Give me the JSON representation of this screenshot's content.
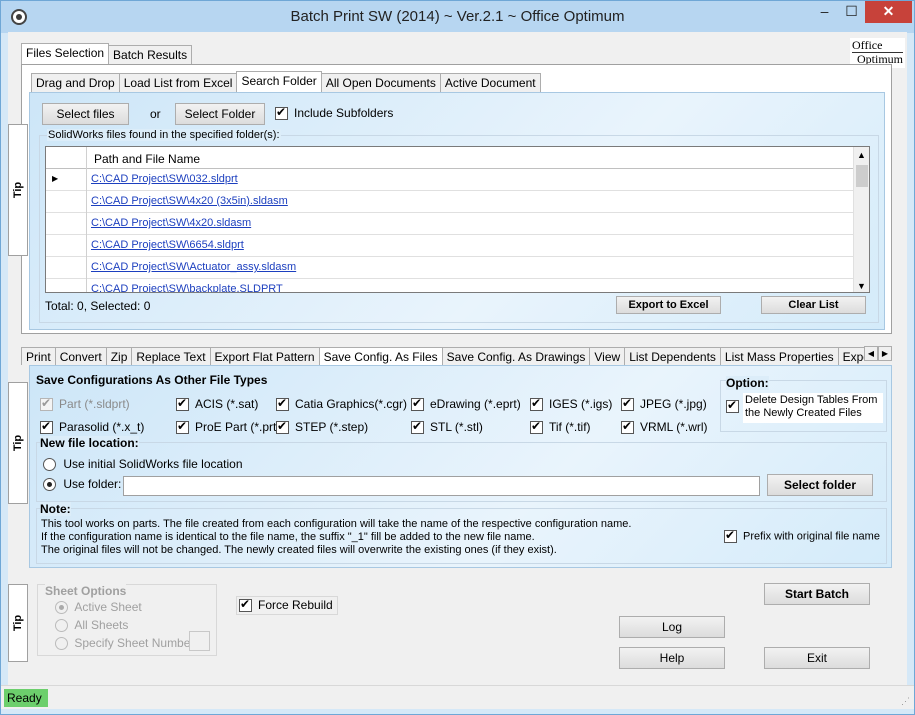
{
  "window": {
    "title": "Batch Print SW (2014) ~ Ver.2.1 ~ Office Optimum",
    "minimize": "‒",
    "maximize": "☐",
    "close": "✕"
  },
  "top_tabs": [
    "Files Selection",
    "Batch Results"
  ],
  "logo": {
    "line1": "Office",
    "line2": "Optimum"
  },
  "source_tabs": [
    "Drag and Drop",
    "Load List from Excel",
    "Search Folder",
    "All Open Documents",
    "Active Document"
  ],
  "search": {
    "select_files": "Select files",
    "or": "or",
    "select_folder": "Select Folder",
    "include_subfolders": "Include Subfolders",
    "found_label": "SolidWorks files found in the specified folder(s):"
  },
  "grid": {
    "column": "Path and File Name",
    "rows": [
      "C:\\CAD Project\\SW\\032.sldprt",
      "C:\\CAD Project\\SW\\4x20 (3x5in).sldasm",
      "C:\\CAD Project\\SW\\4x20.sldasm",
      "C:\\CAD Project\\SW\\6654.sldprt",
      "C:\\CAD Project\\SW\\Actuator_assy.sldasm",
      "C:\\CAD Project\\SW\\backplate.SLDPRT"
    ]
  },
  "footer": {
    "total": "Total: 0, Selected: 0",
    "export": "Export to Excel",
    "clear": "Clear List"
  },
  "tip_label": "Tip",
  "op_tabs": [
    "Print",
    "Convert",
    "Zip",
    "Replace Text",
    "Export Flat Pattern",
    "Save Config. As Files",
    "Save Config. As Drawings",
    "View",
    "List Dependents",
    "List Mass Properties",
    "Export B"
  ],
  "save_config": {
    "heading": "Save Configurations As Other File Types",
    "types": [
      "Part (*.sldprt)",
      "ACIS (*.sat)",
      "Catia Graphics(*.cgr)",
      "eDrawing (*.eprt)",
      "IGES (*.igs)",
      "JPEG (*.jpg)",
      "Parasolid (*.x_t)",
      "ProE Part (*.prt)",
      "STEP (*.step)",
      "STL (*.stl)",
      "Tif (*.tif)",
      "VRML (*.wrl)"
    ],
    "option_heading": "Option:",
    "option_text": "Delete Design Tables From the Newly Created Files",
    "location_heading": "New file location:",
    "use_initial": "Use initial SolidWorks file location",
    "use_folder": "Use folder:",
    "folder_value": "",
    "select_folder": "Select folder",
    "note_heading": "Note:",
    "note_lines": [
      "This tool works on parts. The file created from each configuration will take the name of the respective configuration name.",
      "If the configuration name is identical to the file name, the suffix \"_1\" fill be added to the new file name.",
      "The original files will not be changed. The newly created files will overwrite the existing ones (if they exist)."
    ],
    "prefix": "Prefix with original file name"
  },
  "sheet": {
    "heading": "Sheet Options",
    "active": "Active Sheet",
    "all": "All Sheets",
    "specify": "Specify Sheet Number:",
    "force_rebuild": "Force Rebuild"
  },
  "actions": {
    "start": "Start Batch",
    "log": "Log",
    "help": "Help",
    "exit": "Exit"
  },
  "status": "Ready"
}
